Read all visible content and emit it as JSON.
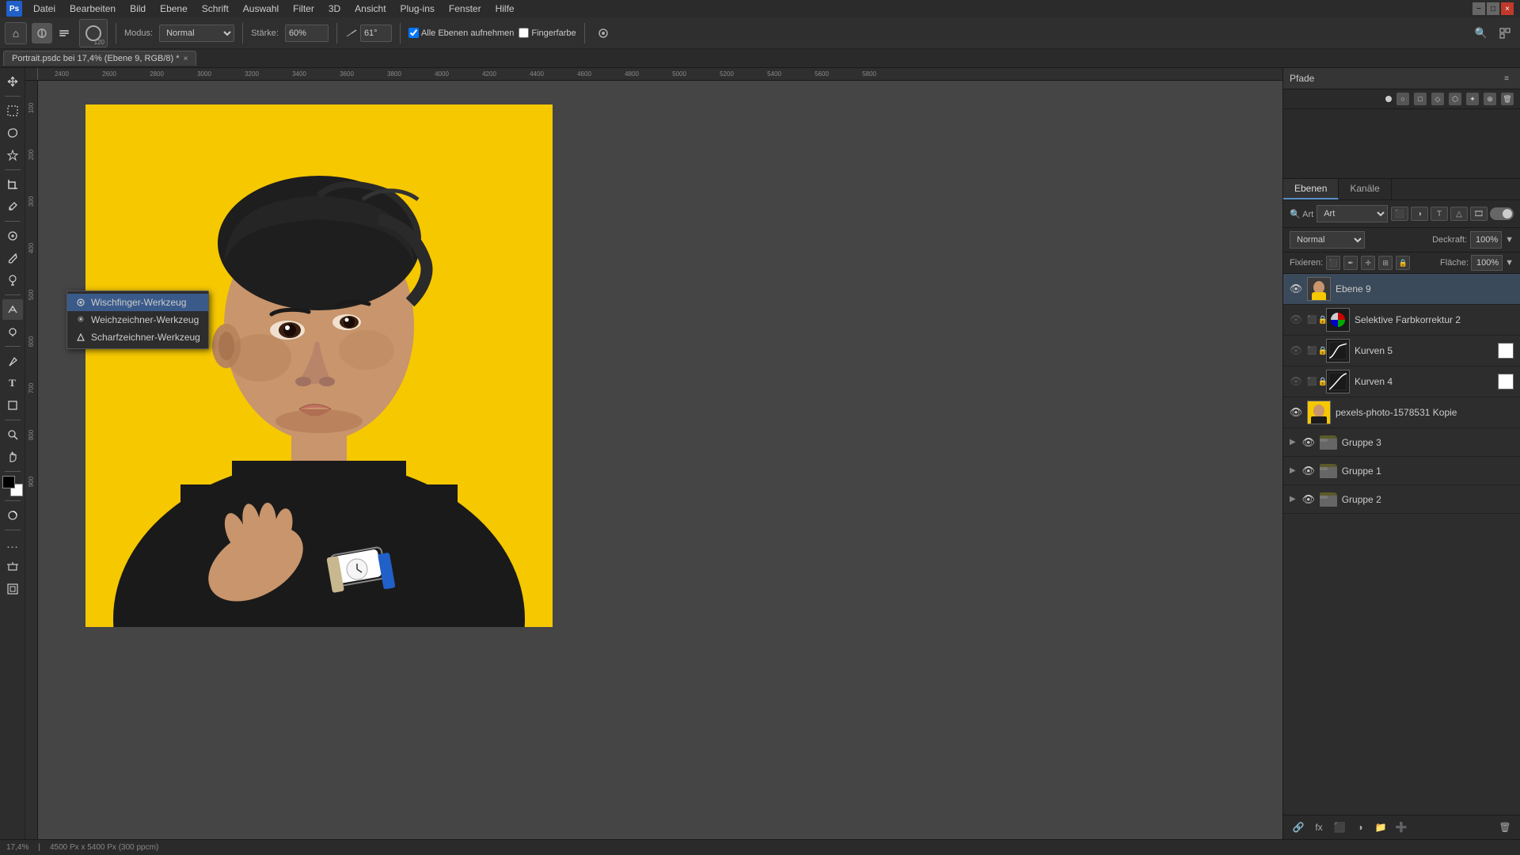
{
  "window": {
    "title": "Portrait.psdc bei 17,4% (Ebene 9, RGB/8) *",
    "close_label": "×",
    "minimize_label": "−",
    "maximize_label": "□"
  },
  "menu": {
    "items": [
      "Datei",
      "Bearbeiten",
      "Bild",
      "Ebene",
      "Schrift",
      "Auswahl",
      "Filter",
      "3D",
      "Ansicht",
      "Plug-ins",
      "Fenster",
      "Hilfe"
    ]
  },
  "toolbar": {
    "modus_label": "Modus:",
    "modus_value": "Normal",
    "staerke_label": "Stärke:",
    "staerke_value": "60%",
    "angle_value": "61°",
    "aufnehmen_label": "Alle Ebenen aufnehmen",
    "fingerfarbe_label": "Fingerfarbe"
  },
  "doc_tab": {
    "name": "Portrait.psdc bei 17,4% (Ebene 9, RGB/8) *"
  },
  "context_menu": {
    "items": [
      {
        "id": "wischfinger",
        "label": "Wischfinger-Werkzeug",
        "icon": "finger"
      },
      {
        "id": "weichzeichner",
        "label": "Weichzeichner-Werkzeug",
        "icon": "blur"
      },
      {
        "id": "scharfzeichner",
        "label": "Scharfzeichner-Werkzeug",
        "icon": "sharpen"
      }
    ]
  },
  "right_panels": {
    "pfade_title": "Pfade",
    "layer_tabs": [
      "Ebenen",
      "Kanäle"
    ],
    "layer_mode": "Normal",
    "opacity_label": "Deckraft:",
    "opacity_value": "100%",
    "fixieren_label": "Fixieren:",
    "flaeche_label": "Fläche:",
    "flaeche_value": "100%",
    "layers": [
      {
        "id": "ebene9",
        "name": "Ebene 9",
        "visible": true,
        "type": "pixel",
        "active": true
      },
      {
        "id": "selfarb2",
        "name": "Selektive Farbkorrektur 2",
        "visible": false,
        "type": "adjustment"
      },
      {
        "id": "kurven5",
        "name": "Kurven 5",
        "visible": false,
        "type": "curve"
      },
      {
        "id": "kurven4",
        "name": "Kurven 4",
        "visible": false,
        "type": "curve"
      },
      {
        "id": "pexels_kopie",
        "name": "pexels-photo-1578531 Kopie",
        "visible": true,
        "type": "photo"
      },
      {
        "id": "gruppe3",
        "name": "Gruppe 3",
        "visible": true,
        "type": "group"
      },
      {
        "id": "gruppe1",
        "name": "Gruppe 1",
        "visible": true,
        "type": "group"
      },
      {
        "id": "gruppe2",
        "name": "Gruppe 2",
        "visible": true,
        "type": "group"
      }
    ]
  },
  "status_bar": {
    "zoom": "17,4%",
    "dimensions": "4500 Px x 5400 Px (300 ppcm)"
  },
  "icons": {
    "eye": "👁",
    "folder": "📁",
    "arrow_right": "▶",
    "lock": "🔒",
    "search": "🔍",
    "home": "⌂",
    "move": "✛",
    "lasso": "⬤",
    "crop": "⊞",
    "heal": "✚",
    "eraser": "◻",
    "brush": "✒",
    "smudge": "⊕",
    "dodge": "◯",
    "pen": "✏",
    "text": "T",
    "shape": "△",
    "zoom_tool": "⊕",
    "fg_color": "■",
    "menu": "≡",
    "close": "✕"
  }
}
